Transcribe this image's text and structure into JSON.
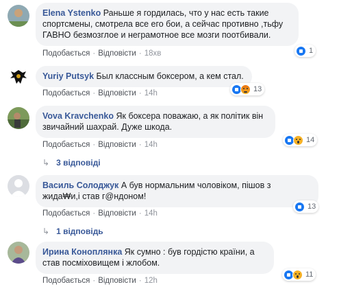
{
  "colors": {
    "name": "#385898",
    "bubble": "#f2f3f5",
    "like": "#1877f2",
    "wow": "#f7b125"
  },
  "actions": {
    "like": "Подобається",
    "reply": "Відповісти"
  },
  "comments": [
    {
      "name": "Elena Ystenko",
      "text": "Раньше я гордилась, что у нас есть такие спортсмены, смотрела все его бои, а сейчас противно ,тьфу ГАВНО безмозглое и неграмотное все мозги поотбивали.",
      "time": "18хв",
      "reactions": [
        "like"
      ],
      "reaction_count": "1"
    },
    {
      "name": "Yuriy Putsyk",
      "text": "Был классным боксером, а кем стал.",
      "time": "14h",
      "reactions": [
        "like",
        "angry"
      ],
      "reaction_count": "13"
    },
    {
      "name": "Vova Kravchenko",
      "text": "Як боксера поважаю, а як політик він звичайний шахрай. Дуже шкода.",
      "time": "14h",
      "reactions": [
        "like",
        "wow"
      ],
      "reaction_count": "14",
      "replies": "3 відповіді"
    },
    {
      "name": "Василь Солоджук",
      "text": "А був нормальним чоловіком, пішов з жида₩и,і став г@ндоном!",
      "time": "14h",
      "reactions": [
        "like"
      ],
      "reaction_count": "13",
      "replies": "1 відповідь"
    },
    {
      "name": "Ирина Коноплянка",
      "text": "Як сумно : був гордістю країни, а став посміховищем і жлобом.",
      "time": "12h",
      "reactions": [
        "like",
        "wow"
      ],
      "reaction_count": "11"
    }
  ]
}
